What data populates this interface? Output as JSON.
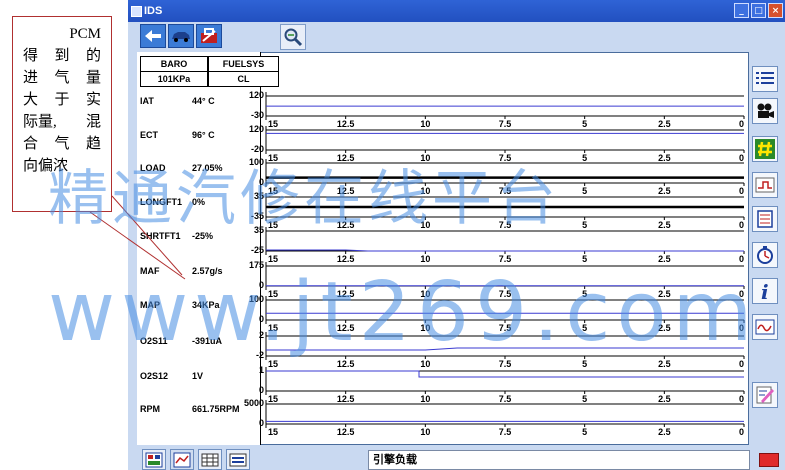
{
  "window": {
    "title": "IDS"
  },
  "summary": [
    {
      "name": "BARO",
      "value": "101KPa"
    },
    {
      "name": "FUELSYS",
      "value": "CL"
    }
  ],
  "pids": [
    {
      "label": "IAT",
      "value": "44° C",
      "ymax": "120",
      "ymin": "-30"
    },
    {
      "label": "ECT",
      "value": "96° C",
      "ymax": "120",
      "ymin": "-20"
    },
    {
      "label": "LOAD",
      "value": "27.05%",
      "ymax": "100",
      "ymin": "0"
    },
    {
      "label": "LONGFT1",
      "value": "0%",
      "ymax": "35",
      "ymin": "-35"
    },
    {
      "label": "SHRTFT1",
      "value": "-25%",
      "ymax": "35",
      "ymin": "-25"
    },
    {
      "label": "MAF",
      "value": "2.57g/s",
      "ymax": "175",
      "ymin": "0"
    },
    {
      "label": "MAP",
      "value": "34KPa",
      "ymax": "100",
      "ymin": "0"
    },
    {
      "label": "O2S11",
      "value": "-391uA",
      "ymax": "2",
      "ymin": "-2"
    },
    {
      "label": "O2S12",
      "value": "1V",
      "ymax": "1",
      "ymin": "0"
    },
    {
      "label": "RPM",
      "value": "661.75RPM",
      "ymax": "5000",
      "ymin": "0"
    }
  ],
  "time_axis": [
    "15",
    "12.5",
    "10",
    "7.5",
    "5",
    "2.5",
    "0"
  ],
  "chart_data": {
    "type": "line",
    "x_label": "",
    "x_range": [
      15,
      0
    ],
    "x_ticks": [
      15,
      12.5,
      10,
      7.5,
      5,
      2.5,
      0
    ],
    "series": [
      {
        "pid": "IAT",
        "points": [
          [
            15,
            44
          ],
          [
            0,
            44
          ]
        ]
      },
      {
        "pid": "ECT",
        "points": [
          [
            15,
            96
          ],
          [
            0,
            96
          ]
        ]
      },
      {
        "pid": "LOAD",
        "points": [
          [
            15,
            27
          ],
          [
            0,
            27
          ]
        ]
      },
      {
        "pid": "LONGFT1",
        "points": [
          [
            15,
            0
          ],
          [
            0,
            0
          ]
        ]
      },
      {
        "pid": "SHRTFT1",
        "points": [
          [
            15,
            -22
          ],
          [
            12.5,
            -22
          ],
          [
            11.8,
            -25
          ],
          [
            0,
            -25
          ]
        ]
      },
      {
        "pid": "MAF",
        "points": [
          [
            15,
            2.6
          ],
          [
            0,
            2.6
          ]
        ]
      },
      {
        "pid": "MAP",
        "points": [
          [
            15,
            34
          ],
          [
            0,
            34
          ]
        ]
      },
      {
        "pid": "O2S11",
        "points": [
          [
            15,
            -0.8
          ],
          [
            10,
            -0.8
          ],
          [
            9,
            -0.4
          ],
          [
            0,
            -0.4
          ]
        ]
      },
      {
        "pid": "O2S12",
        "points": [
          [
            15,
            1
          ],
          [
            10.2,
            1
          ],
          [
            10.2,
            0.7
          ],
          [
            0,
            0.7
          ]
        ]
      },
      {
        "pid": "RPM",
        "points": [
          [
            15,
            662
          ],
          [
            0,
            662
          ]
        ]
      }
    ]
  },
  "status": {
    "text": "引擎负载"
  },
  "annotation": {
    "lines": [
      [
        "PCM"
      ],
      [
        "得",
        "到",
        "的"
      ],
      [
        "进",
        "气",
        "量"
      ],
      [
        "大",
        "于",
        "实"
      ],
      [
        "际量,",
        "混"
      ],
      [
        "合",
        "气",
        "趋"
      ],
      [
        "向偏浓"
      ]
    ]
  },
  "watermark": {
    "line1": "精通汽修在线平台",
    "line2": "www.jt269.com"
  },
  "icons": {
    "toolbar": [
      "back-arrow-icon",
      "car-icon",
      "toolbox-icon",
      "magnifier-icon"
    ],
    "side": [
      "list-icon",
      "camera-icon",
      "hash-icon",
      "trigger-icon",
      "notes-icon",
      "stopwatch-icon",
      "info-icon",
      "scope-icon",
      "edit-icon"
    ],
    "bottom": [
      "grid-view-icon",
      "graph-view-icon",
      "table-view-icon",
      "meter-view-icon"
    ]
  },
  "colors": {
    "trace": "#3a3ad0",
    "trace_bold": "#000000",
    "titlebar": "#2250c0",
    "watermark": "#468ce1"
  }
}
